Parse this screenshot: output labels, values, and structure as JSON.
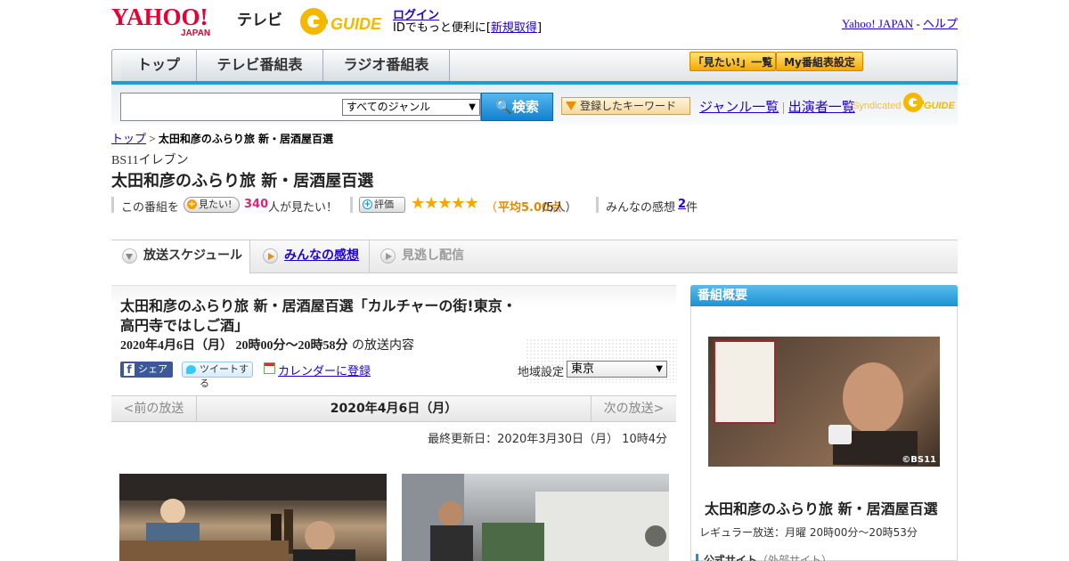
{
  "header": {
    "logo_yahoo": "YAHOO!",
    "logo_japan": "JAPAN",
    "logo_tv": "テレビ",
    "logo_guide": "GUIDE",
    "login": "ログイン",
    "login_sub_prefix": "IDでもっと便利に[",
    "signup": "新規取得",
    "login_sub_suffix": "]",
    "yahoo_japan": "Yahoo! JAPAN",
    "sep": " - ",
    "help": "ヘルプ"
  },
  "nav": {
    "tabs": [
      "トップ",
      "テレビ番組表",
      "ラジオ番組表"
    ],
    "want_list": "「見たい!」一覧",
    "my_schedule": "My番組表設定"
  },
  "search": {
    "genre_selected": "すべてのジャンル",
    "button": "検索",
    "keyword_button": "登録したキーワード",
    "genre_list": "ジャンル一覧",
    "divider": "|",
    "performer_list": "出演者一覧",
    "syndicated": "Syndicated"
  },
  "breadcrumb": {
    "top": "トップ",
    "sep": " > ",
    "current": "太田和彦のふらり旅 新・居酒屋百選"
  },
  "program": {
    "channel": "BS11イレブン",
    "title": "太田和彦のふらり旅 新・居酒屋百選",
    "want_prefix": "この番組を",
    "want_button": "見たい!",
    "want_count": "340",
    "want_suffix": "人が見たい！",
    "rating_button": "評価",
    "stars": "★★★★★",
    "rating_open": "（",
    "rating_avg": "平均5.00点",
    "rating_people": "/5人）",
    "impressions_label": "みんなの感想",
    "impressions_count": "2",
    "impressions_unit": "件"
  },
  "tabs": {
    "schedule": "放送スケジュール",
    "impressions": "みんなの感想",
    "missed": "見逃し配信"
  },
  "episode": {
    "title": "太田和彦のふらり旅 新・居酒屋百選「カルチャーの街!東京・高円寺ではしご酒」",
    "date": "2020年4月6日（月） 20時00分～20時58分",
    "date_suffix": "の放送内容",
    "share_fb": "シェア",
    "share_tw": "ツイートする",
    "calendar": "カレンダーに登録",
    "region_label": "地域設定",
    "region_value": "東京",
    "prev": "<前の放送",
    "pager_date": "2020年4月6日（月）",
    "next": "次の放送>",
    "updated": "最終更新日：2020年3月30日（月） 10時4分"
  },
  "sidebar": {
    "heading": "番組概要",
    "image_copyright": "©BS11",
    "title": "太田和彦のふらり旅 新・居酒屋百選",
    "regular": "レギュラー放送：月曜 20時00分～20時53分",
    "official": "公式サイト",
    "official_note": "（外部サイト）"
  },
  "colors": {
    "accent_blue": "#1a93d6",
    "star": "#f4a800",
    "want_count": "#e0247a",
    "rating_text": "#e08a00"
  }
}
